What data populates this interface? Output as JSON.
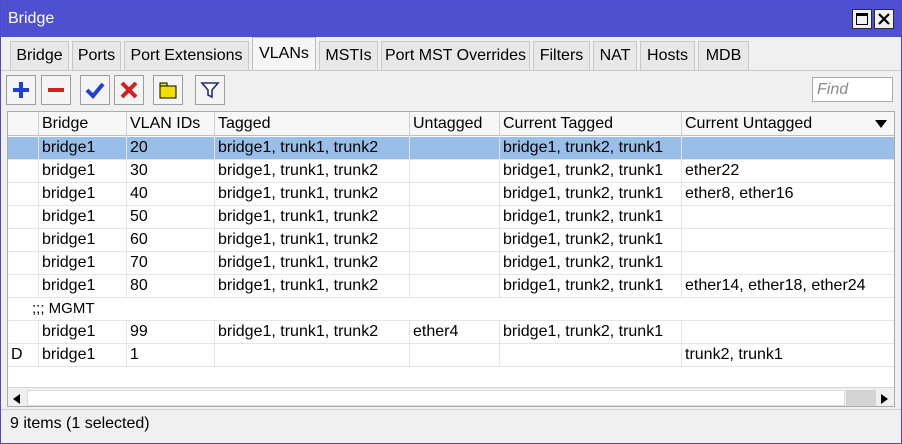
{
  "window": {
    "title": "Bridge"
  },
  "tabs": [
    {
      "label": "Bridge",
      "active": false
    },
    {
      "label": "Ports",
      "active": false
    },
    {
      "label": "Port Extensions",
      "active": false
    },
    {
      "label": "VLANs",
      "active": true
    },
    {
      "label": "MSTIs",
      "active": false
    },
    {
      "label": "Port MST Overrides",
      "active": false
    },
    {
      "label": "Filters",
      "active": false
    },
    {
      "label": "NAT",
      "active": false
    },
    {
      "label": "Hosts",
      "active": false
    },
    {
      "label": "MDB",
      "active": false
    }
  ],
  "toolbar": {
    "icons": [
      "plus-icon",
      "minus-icon",
      "check-icon",
      "cross-icon",
      "comment-icon",
      "filter-icon"
    ],
    "find_placeholder": "Find"
  },
  "table": {
    "columns": [
      "",
      "Bridge",
      "VLAN IDs",
      "Tagged",
      "Untagged",
      "Current Tagged",
      "Current Untagged"
    ],
    "sorted_column": "Bridge",
    "rows": [
      {
        "flag": "",
        "bridge": "bridge1",
        "vlan_ids": "20",
        "tagged": "bridge1, trunk1, trunk2",
        "untagged": "",
        "current_tagged": "bridge1, trunk2, trunk1",
        "current_untagged": "",
        "selected": true
      },
      {
        "flag": "",
        "bridge": "bridge1",
        "vlan_ids": "30",
        "tagged": "bridge1, trunk1, trunk2",
        "untagged": "",
        "current_tagged": "bridge1, trunk2, trunk1",
        "current_untagged": "ether22"
      },
      {
        "flag": "",
        "bridge": "bridge1",
        "vlan_ids": "40",
        "tagged": "bridge1, trunk1, trunk2",
        "untagged": "",
        "current_tagged": "bridge1, trunk2, trunk1",
        "current_untagged": "ether8, ether16"
      },
      {
        "flag": "",
        "bridge": "bridge1",
        "vlan_ids": "50",
        "tagged": "bridge1, trunk1, trunk2",
        "untagged": "",
        "current_tagged": "bridge1, trunk2, trunk1",
        "current_untagged": ""
      },
      {
        "flag": "",
        "bridge": "bridge1",
        "vlan_ids": "60",
        "tagged": "bridge1, trunk1, trunk2",
        "untagged": "",
        "current_tagged": "bridge1, trunk2, trunk1",
        "current_untagged": ""
      },
      {
        "flag": "",
        "bridge": "bridge1",
        "vlan_ids": "70",
        "tagged": "bridge1, trunk1, trunk2",
        "untagged": "",
        "current_tagged": "bridge1, trunk2, trunk1",
        "current_untagged": ""
      },
      {
        "flag": "",
        "bridge": "bridge1",
        "vlan_ids": "80",
        "tagged": "bridge1, trunk1, trunk2",
        "untagged": "",
        "current_tagged": "bridge1, trunk2, trunk1",
        "current_untagged": "ether14, ether18, ether24"
      },
      {
        "comment": ";;; MGMT"
      },
      {
        "flag": "",
        "bridge": "bridge1",
        "vlan_ids": "99",
        "tagged": "bridge1, trunk1, trunk2",
        "untagged": "ether4",
        "current_tagged": "bridge1, trunk2, trunk1",
        "current_untagged": ""
      },
      {
        "flag": "D",
        "bridge": "bridge1",
        "vlan_ids": "1",
        "tagged": "",
        "untagged": "",
        "current_tagged": "",
        "current_untagged": "trunk2, trunk1"
      }
    ]
  },
  "status": {
    "text": "9 items (1 selected)"
  },
  "colors": {
    "titlebar": "#4e50d0",
    "selected_row": "#99bfe8",
    "plus": "#1f3fd6",
    "minus": "#d42020",
    "check": "#1f3fd6",
    "cross": "#d42020",
    "comment": "#f0e000"
  }
}
